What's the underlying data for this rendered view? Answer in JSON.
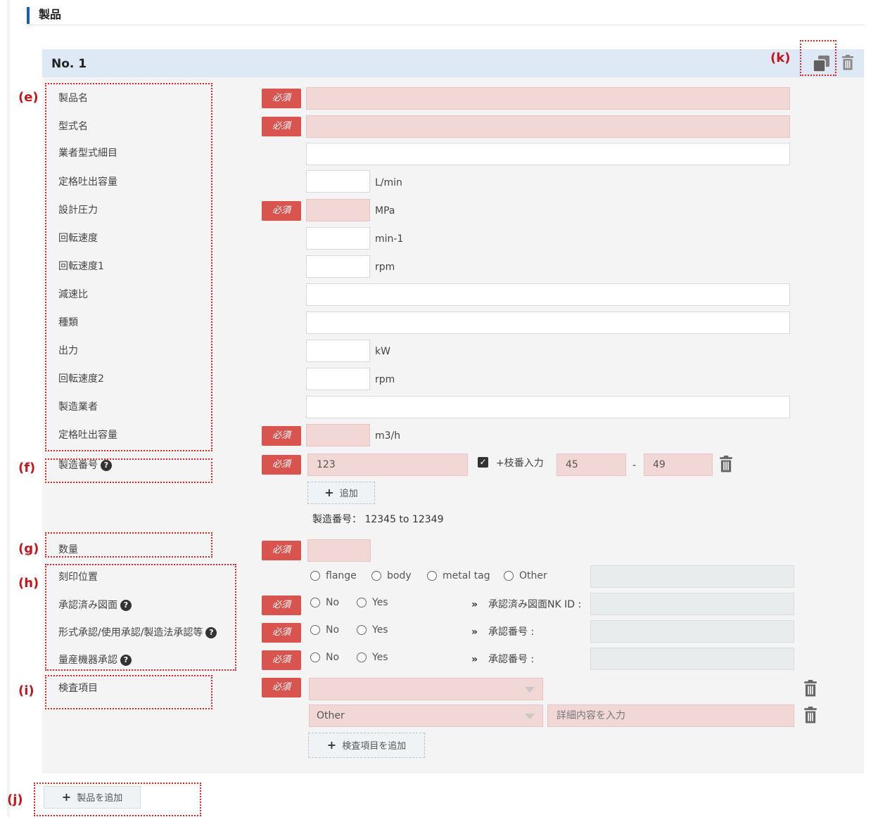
{
  "section": {
    "title": "製品"
  },
  "product": {
    "number_label": "No. 1"
  },
  "required_badge": "必須",
  "fields": {
    "product_name": {
      "label": "製品名"
    },
    "model_name": {
      "label": "型式名"
    },
    "vendor_model_detail": {
      "label": "業者型式細目"
    },
    "rated_discharge_lmin": {
      "label": "定格吐出容量",
      "unit": "L/min"
    },
    "design_pressure": {
      "label": "設計圧力",
      "unit": "MPa"
    },
    "rotation_speed": {
      "label": "回転速度",
      "unit": "min-1"
    },
    "rotation_speed_1": {
      "label": "回転速度1",
      "unit": "rpm"
    },
    "reduction_ratio": {
      "label": "減速比"
    },
    "type": {
      "label": "種類"
    },
    "output": {
      "label": "出力",
      "unit": "kW"
    },
    "rotation_speed_2": {
      "label": "回転速度2",
      "unit": "rpm"
    },
    "manufacturer": {
      "label": "製造業者"
    },
    "rated_discharge_m3h": {
      "label": "定格吐出容量",
      "unit": "m3/h"
    }
  },
  "serial": {
    "label": "製造番号",
    "value": "123",
    "branch_checkbox_label": "+枝番入力",
    "branch_from": "45",
    "branch_sep": "-",
    "branch_to": "49",
    "add_label": "追加",
    "summary": "製造番号：  12345 to 12349"
  },
  "quantity": {
    "label": "数量"
  },
  "stamp": {
    "label": "刻印位置",
    "options": [
      "flange",
      "body",
      "metal tag",
      "Other"
    ]
  },
  "approved_drawing": {
    "label": "承認済み図面",
    "options": [
      "No",
      "Yes"
    ],
    "ref_label": "承認済み図面NK ID :"
  },
  "type_approval": {
    "label": "形式承認/使用承認/製造法承認等",
    "options": [
      "No",
      "Yes"
    ],
    "ref_label": "承認番号 :"
  },
  "mass_production": {
    "label": "量産機器承認",
    "options": [
      "No",
      "Yes"
    ],
    "ref_label": "承認番号 :"
  },
  "inspection": {
    "label": "検査項目",
    "row2_value": "Other",
    "detail_placeholder": "詳細内容を入力",
    "add_label": "検査項目を追加"
  },
  "add_product_label": "製品を追加",
  "callouts": {
    "e": "(e)",
    "f": "(f)",
    "g": "(g)",
    "h": "(h)",
    "i": "(i)",
    "j": "(j)",
    "k": "(k)"
  },
  "icons": {
    "copy": "copy-icon",
    "delete": "trash-icon",
    "help": "question-circle-icon",
    "select": "caret-down-icon",
    "branch": "checkbox-checked-icon",
    "arrow": "double-chevron-right-icon"
  }
}
